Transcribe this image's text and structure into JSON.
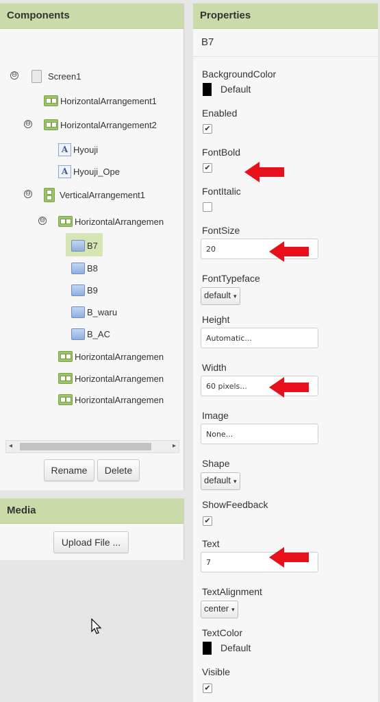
{
  "components": {
    "title": "Components",
    "tree": [
      {
        "label": "Screen1",
        "icon": "screen-icon"
      },
      {
        "label": "HorizontalArrangement1",
        "icon": "horizontal-arrangement-icon"
      },
      {
        "label": "HorizontalArrangement2",
        "icon": "horizontal-arrangement-icon"
      },
      {
        "label": "Hyouji",
        "icon": "label-icon"
      },
      {
        "label": "Hyouji_Ope",
        "icon": "label-icon"
      },
      {
        "label": "VerticalArrangement1",
        "icon": "vertical-arrangement-icon"
      },
      {
        "label": "HorizontalArrangemen",
        "icon": "horizontal-arrangement-icon"
      },
      {
        "label": "B7",
        "icon": "button-icon",
        "selected": true
      },
      {
        "label": "B8",
        "icon": "button-icon"
      },
      {
        "label": "B9",
        "icon": "button-icon"
      },
      {
        "label": "B_waru",
        "icon": "button-icon"
      },
      {
        "label": "B_AC",
        "icon": "button-icon"
      },
      {
        "label": "HorizontalArrangemen",
        "icon": "horizontal-arrangement-icon"
      },
      {
        "label": "HorizontalArrangemen",
        "icon": "horizontal-arrangement-icon"
      },
      {
        "label": "HorizontalArrangemen",
        "icon": "horizontal-arrangement-icon"
      }
    ],
    "toggle_symbol": "⊖",
    "rename_label": "Rename",
    "delete_label": "Delete"
  },
  "media": {
    "title": "Media",
    "upload_label": "Upload File ..."
  },
  "properties": {
    "title": "Properties",
    "selected_component": "B7",
    "check_mark": "✔",
    "dropdown_caret": "▾",
    "background_color": {
      "label": "BackgroundColor",
      "value": "Default",
      "swatch": "#000000"
    },
    "enabled": {
      "label": "Enabled",
      "checked": true
    },
    "font_bold": {
      "label": "FontBold",
      "checked": true
    },
    "font_italic": {
      "label": "FontItalic",
      "checked": false
    },
    "font_size": {
      "label": "FontSize",
      "value": "20"
    },
    "font_typeface": {
      "label": "FontTypeface",
      "value": "default"
    },
    "height": {
      "label": "Height",
      "value": "Automatic..."
    },
    "width": {
      "label": "Width",
      "value": "60 pixels..."
    },
    "image": {
      "label": "Image",
      "value": "None..."
    },
    "shape": {
      "label": "Shape",
      "value": "default"
    },
    "show_feedback": {
      "label": "ShowFeedback",
      "checked": true
    },
    "text": {
      "label": "Text",
      "value": "7"
    },
    "text_alignment": {
      "label": "TextAlignment",
      "value": "center"
    },
    "text_color": {
      "label": "TextColor",
      "value": "Default",
      "swatch": "#000000"
    },
    "visible": {
      "label": "Visible",
      "checked": true
    }
  },
  "colors": {
    "header_bg": "#c9dba8",
    "selection_bg": "#d5e5b6",
    "annotation_arrow": "#e8101a"
  }
}
